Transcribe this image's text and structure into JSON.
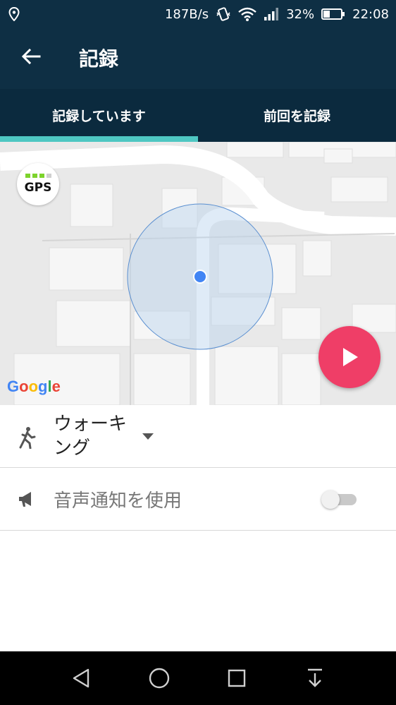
{
  "status_bar": {
    "network_speed": "187B/s",
    "battery_percent": "32%",
    "time": "22:08",
    "icons": [
      "location-icon",
      "vibrate-icon",
      "wifi-icon",
      "signal-icon",
      "battery-icon"
    ]
  },
  "app_bar": {
    "title": "記録",
    "back_icon": "arrow-back-icon"
  },
  "tabs": [
    {
      "label": "記録しています",
      "active": true
    },
    {
      "label": "前回を記録",
      "active": false
    }
  ],
  "map": {
    "gps_label": "GPS",
    "gps_strength": 0.75,
    "attribution": "Google",
    "start_button_icon": "play-icon"
  },
  "activity": {
    "label": "ウォーキング",
    "line1": "ウォーキ",
    "line2": "ング",
    "icon": "walking-icon"
  },
  "voice_notification": {
    "label": "音声通知を使用",
    "icon": "megaphone-icon",
    "enabled": false
  },
  "nav_bar": [
    "back-triangle-icon",
    "home-circle-icon",
    "recents-square-icon",
    "notification-pull-icon"
  ],
  "colors": {
    "app_bar": "#0e2f44",
    "tab_indicator": "#4ec7c2",
    "fab": "#ef3e67",
    "location_dot": "#4285f4"
  }
}
